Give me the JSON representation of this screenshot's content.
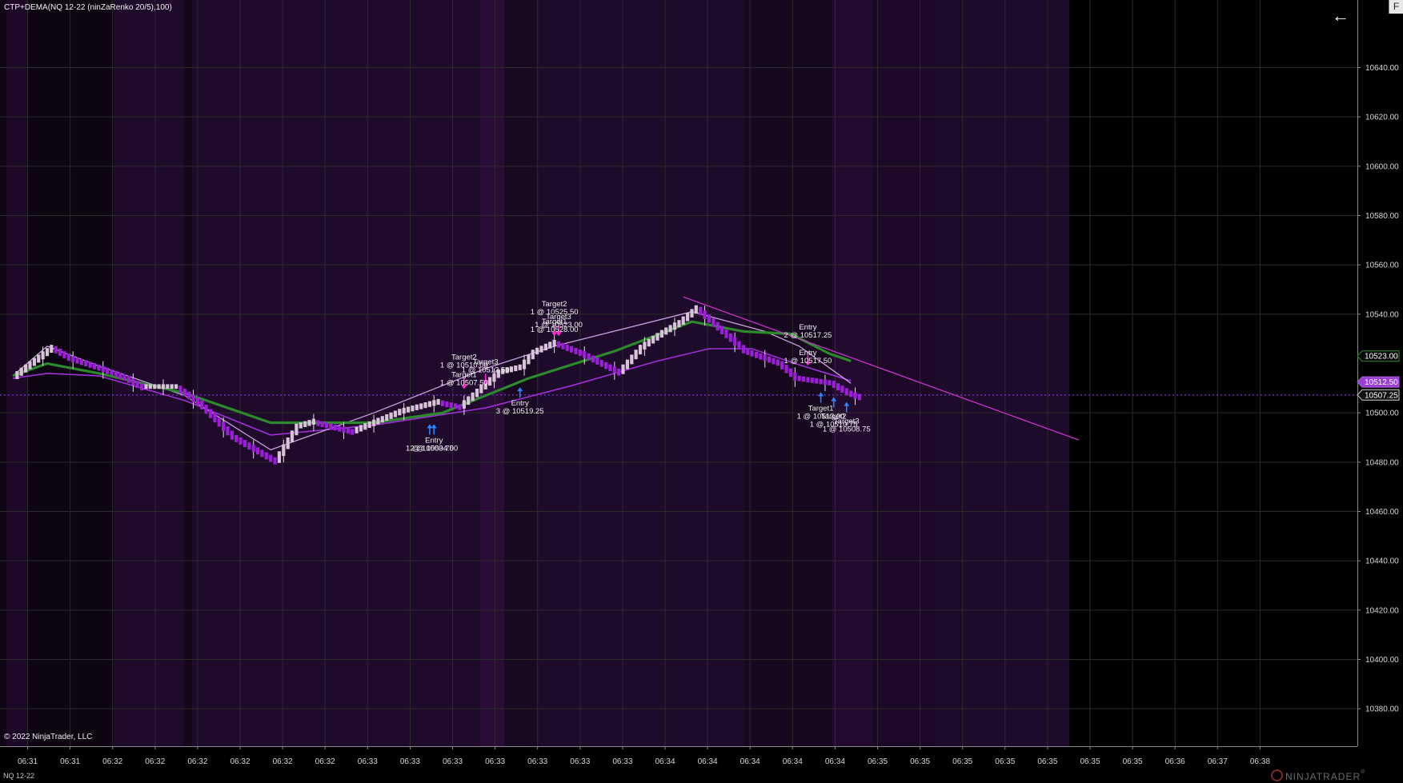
{
  "header": {
    "indicator_label": "CTP+DEMA(NQ 12-22 (ninZaRenko 20/5),100)"
  },
  "footer": {
    "copyright": "© 2022 NinjaTrader, LLC",
    "instrument": "NQ 12-22",
    "brand": "NINJATRADER",
    "brand_mark": "®"
  },
  "toolbar": {
    "corner_label": "F",
    "back_icon": "arrow-left-icon"
  },
  "colors": {
    "bull_bar": "#d8c3d8",
    "bear_bar": "#9a1fd6",
    "green_line": "#2c8a2c",
    "purple_line": "#a030d8",
    "lavender_line": "#c9a0e0",
    "trend_line": "#d535d5",
    "entry_arrow": "#2a86ff",
    "exit_arrow": "#ff2cd2",
    "background": "#000000",
    "band_purple": "#1f0a2b"
  },
  "chart_data": {
    "type": "candlestick",
    "ylim": [
      10372,
      10662
    ],
    "y_ticks": [
      10640,
      10620,
      10600,
      10580,
      10560,
      10540,
      10500,
      10480,
      10460,
      10440,
      10420,
      10400,
      10380
    ],
    "y_tick_labels": [
      "10640.00",
      "10620.00",
      "10600.00",
      "10580.00",
      "10560.00",
      "10540.00",
      "10500.00",
      "10480.00",
      "10460.00",
      "10440.00",
      "10420.00",
      "10400.00",
      "10380.00"
    ],
    "x_tick_labels": [
      "06:31",
      "06:31",
      "06:32",
      "06:32",
      "06:32",
      "06:32",
      "06:32",
      "06:32",
      "06:33",
      "06:33",
      "06:33",
      "06:33",
      "06:33",
      "06:33",
      "06:33",
      "06:34",
      "06:34",
      "06:34",
      "06:34",
      "06:34",
      "06:35",
      "06:35",
      "06:35",
      "06:35",
      "06:35",
      "06:35",
      "06:35",
      "06:36",
      "06:37",
      "06:38"
    ],
    "price_tags": [
      {
        "label": "10523.00",
        "value": 10523.0,
        "style": "green"
      },
      {
        "label": "10512.50",
        "value": 10512.5,
        "style": "purple"
      },
      {
        "label": "10507.25",
        "value": 10507.25,
        "style": "dark"
      }
    ],
    "current_price": 10507.25,
    "path": [
      [
        0,
        10515
      ],
      [
        9,
        10527
      ],
      [
        13,
        10523
      ],
      [
        20,
        10519
      ],
      [
        26,
        10515
      ],
      [
        30,
        10511
      ],
      [
        38,
        10511
      ],
      [
        43,
        10505
      ],
      [
        51,
        10491
      ],
      [
        61,
        10481
      ],
      [
        66,
        10495
      ],
      [
        70,
        10497
      ],
      [
        79,
        10493
      ],
      [
        90,
        10501
      ],
      [
        99,
        10505
      ],
      [
        104,
        10503
      ],
      [
        113,
        10517
      ],
      [
        118,
        10519
      ],
      [
        121,
        10525
      ],
      [
        126,
        10529
      ],
      [
        132,
        10525
      ],
      [
        141,
        10517
      ],
      [
        146,
        10527
      ],
      [
        151,
        10533
      ],
      [
        155,
        10537
      ],
      [
        159,
        10543
      ],
      [
        170,
        10526
      ],
      [
        178,
        10521
      ],
      [
        182,
        10515
      ],
      [
        190,
        10513
      ],
      [
        194,
        10509
      ],
      [
        197,
        10507
      ]
    ],
    "green_line": [
      [
        0,
        10515
      ],
      [
        8,
        10520
      ],
      [
        20,
        10516
      ],
      [
        40,
        10508
      ],
      [
        60,
        10496
      ],
      [
        84,
        10496
      ],
      [
        100,
        10500
      ],
      [
        120,
        10514
      ],
      [
        140,
        10525
      ],
      [
        158,
        10537
      ],
      [
        170,
        10533
      ],
      [
        181,
        10532
      ],
      [
        190,
        10524
      ],
      [
        195,
        10521
      ]
    ],
    "purple_line": [
      [
        0,
        10514
      ],
      [
        8,
        10516
      ],
      [
        20,
        10515
      ],
      [
        40,
        10505
      ],
      [
        60,
        10491
      ],
      [
        84,
        10495
      ],
      [
        110,
        10502
      ],
      [
        130,
        10511
      ],
      [
        150,
        10521
      ],
      [
        162,
        10526
      ],
      [
        172,
        10526
      ],
      [
        182,
        10520
      ],
      [
        195,
        10513
      ]
    ],
    "lavender_line": [
      [
        0,
        10515
      ],
      [
        8,
        10527
      ],
      [
        20,
        10519
      ],
      [
        40,
        10507
      ],
      [
        60,
        10485
      ],
      [
        84,
        10500
      ],
      [
        110,
        10518
      ],
      [
        126,
        10527
      ],
      [
        158,
        10541
      ],
      [
        175,
        10533
      ],
      [
        183,
        10527
      ],
      [
        195,
        10512
      ]
    ],
    "trend_line": {
      "from": [
        156,
        10547
      ],
      "to": [
        248,
        10489
      ]
    },
    "annotations": [
      {
        "lines": [
          "Target2",
          "1 @ 10510.00"
        ],
        "bar": 105,
        "value": 10508.0,
        "offset": 32,
        "arrow": "down",
        "color": "exit"
      },
      {
        "lines": [
          "Target3",
          "1 @ 10512.50"
        ],
        "bar": 110,
        "value": 10510.0,
        "offset": 20,
        "arrow": "down",
        "color": "exit"
      },
      {
        "lines": [
          "Target1",
          "1 @ 10507.50"
        ],
        "bar": 105,
        "value": 10508.0,
        "offset": 10,
        "arrow": "none",
        "color": "exit"
      },
      {
        "lines": [
          "Entry",
          "2 @ 10504.00"
        ],
        "bar": 98,
        "value": 10497.0,
        "offset": -18,
        "arrow": "up",
        "color": "entry"
      },
      {
        "lines": [
          "1 @ 10503.75"
        ],
        "bar": 97,
        "value": 10497.0,
        "offset": -28,
        "arrow": "up",
        "color": "entry"
      },
      {
        "lines": [
          "Entry",
          "3 @ 10519.25"
        ],
        "bar": 118,
        "value": 10512.0,
        "offset": -18,
        "arrow": "up",
        "color": "entry"
      },
      {
        "lines": [
          "Target2",
          "1 @ 10525.50"
        ],
        "bar": 126,
        "value": 10529.5,
        "offset": 32,
        "arrow": "down",
        "color": "exit"
      },
      {
        "lines": [
          "Target3",
          "1 @ 10523.00"
        ],
        "bar": 127,
        "value": 10529.5,
        "offset": 16,
        "arrow": "down",
        "color": "exit"
      },
      {
        "lines": [
          "Target1",
          "1 @ 10528.00"
        ],
        "bar": 126,
        "value": 10529.5,
        "offset": 10,
        "arrow": "none",
        "color": "exit"
      },
      {
        "lines": [
          "Entry",
          "2 @ 10517.25"
        ],
        "bar": 185,
        "value": 10517.5,
        "offset": 40,
        "arrow": "none",
        "color": "exit"
      },
      {
        "lines": [
          "Entry",
          "1 @ 10517.50"
        ],
        "bar": 185,
        "value": 10517.5,
        "offset": 8,
        "arrow": "down",
        "color": "exit"
      },
      {
        "lines": [
          "Target1",
          "1 @ 10513.00"
        ],
        "bar": 188,
        "value": 10510.0,
        "offset": -18,
        "arrow": "up",
        "color": "entry"
      },
      {
        "lines": [
          "Target2",
          "1 @ 10510.75"
        ],
        "bar": 191,
        "value": 10508.0,
        "offset": -22,
        "arrow": "up",
        "color": "entry"
      },
      {
        "lines": [
          "Target3",
          "1 @ 10508.75"
        ],
        "bar": 194,
        "value": 10506.0,
        "offset": -22,
        "arrow": "up",
        "color": "entry"
      }
    ]
  }
}
